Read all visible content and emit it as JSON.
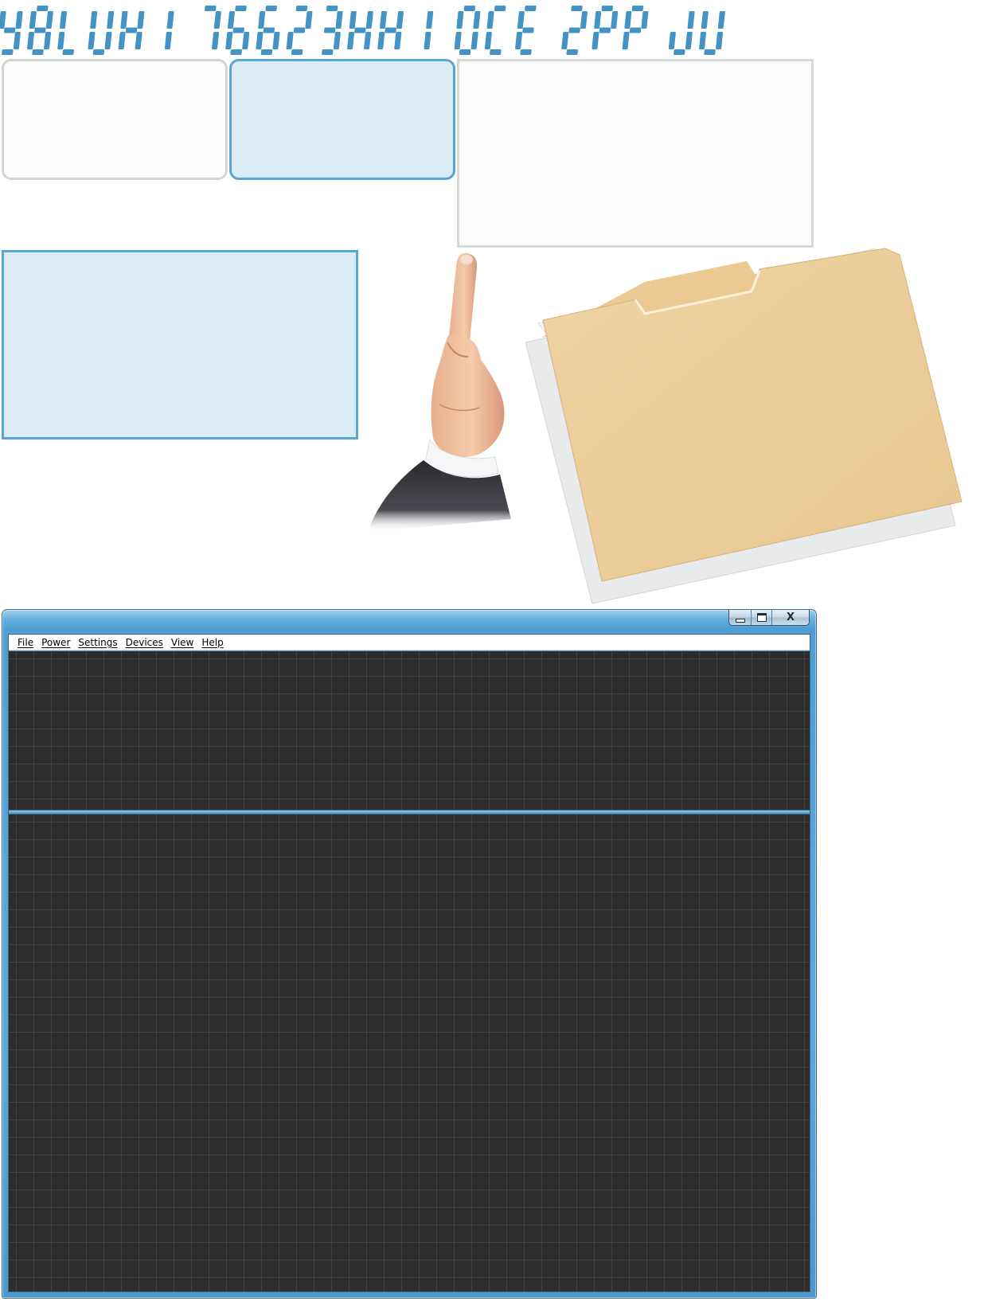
{
  "banner": {
    "glyphs": [
      "Y",
      "8",
      "L",
      "U",
      "H",
      "",
      "I",
      "7",
      "6",
      "6",
      "2",
      "3",
      "H",
      "K",
      "",
      "I",
      "O",
      "C",
      "E",
      "",
      "Z",
      "P",
      "P",
      "",
      "J",
      "U"
    ],
    "color": "#4393c5"
  },
  "panels": {
    "grey_fill": "#fcfcfc",
    "grey_border": "#cdd6d3",
    "blue_fill": "#dbebf3",
    "blue_border": "#5aa5cf"
  },
  "illustrations": {
    "hand": "pointing-hand-image",
    "folder": "manila-folder-image"
  },
  "window": {
    "title": "",
    "caption_buttons": {
      "minimize_icon": "minimize-icon",
      "maximize_icon": "maximize-icon",
      "close_label": "X"
    },
    "menu": {
      "file": "File",
      "power": "Power",
      "settings": "Settings",
      "devices": "Devices",
      "view": "View",
      "help": "Help"
    },
    "frame_color": "#5ba8da",
    "pane_color": "#2d2d2d"
  }
}
